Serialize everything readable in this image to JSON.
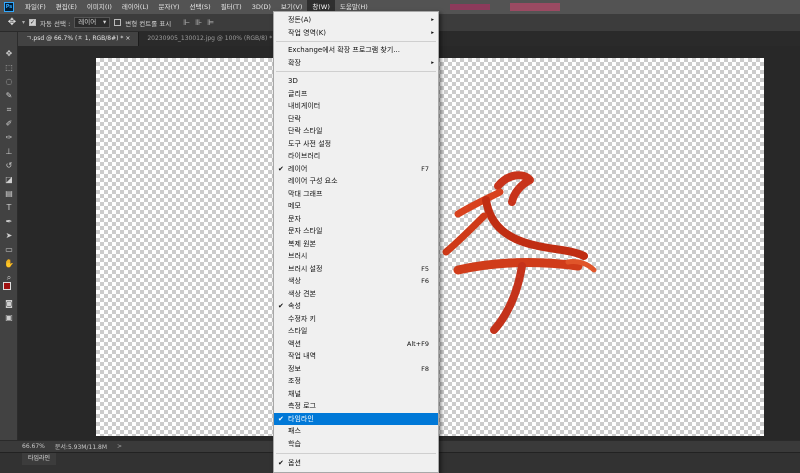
{
  "menubar": {
    "logo": "Ps",
    "items": [
      "파일(F)",
      "편집(E)",
      "이미지(I)",
      "레이어(L)",
      "문자(Y)",
      "선택(S)",
      "필터(T)",
      "3D(D)",
      "보기(V)",
      "창(W)",
      "도움말(H)"
    ]
  },
  "options": {
    "auto_select_label": "자동 선택 :",
    "auto_select_value": "레이어",
    "transform_label": "변형 컨트롤 표시"
  },
  "tabs": [
    {
      "label": "ㄱ.psd @ 66.7% (ㅊ 1, RGB/8#) *",
      "close": "×"
    },
    {
      "label": "20230905_130012.jpg @ 100% (RGB/8) *",
      "close": "×"
    }
  ],
  "status": {
    "zoom": "66.67%",
    "doc": "문서:5.93M/11.8M",
    "arrow": ">"
  },
  "timeline": {
    "tab_label": "타임라인"
  },
  "window_menu": {
    "accent_color": "#0078d7",
    "items": [
      {
        "label": "정돈(A)",
        "submenu": "▸"
      },
      {
        "label": "작업 영역(K)",
        "submenu": "▸"
      },
      {
        "separator": true
      },
      {
        "label": "Exchange에서 확장 프로그램 찾기..."
      },
      {
        "label": "확장",
        "submenu": "▸"
      },
      {
        "separator": true
      },
      {
        "label": "3D"
      },
      {
        "label": "글리프"
      },
      {
        "label": "내비게이터"
      },
      {
        "label": "단락"
      },
      {
        "label": "단락 스타일"
      },
      {
        "label": "도구 사전 설정"
      },
      {
        "label": "라이브러리"
      },
      {
        "label": "레이어",
        "check": "✔",
        "shortcut": "F7"
      },
      {
        "label": "레이어 구성 요소"
      },
      {
        "label": "막대 그래프"
      },
      {
        "label": "메모"
      },
      {
        "label": "문자"
      },
      {
        "label": "문자 스타일"
      },
      {
        "label": "복제 원본"
      },
      {
        "label": "브러시"
      },
      {
        "label": "브러시 설정",
        "shortcut": "F5"
      },
      {
        "label": "색상",
        "shortcut": "F6"
      },
      {
        "label": "색상 견본"
      },
      {
        "label": "속성",
        "check": "✔"
      },
      {
        "label": "수정자 키"
      },
      {
        "label": "스타일"
      },
      {
        "label": "액션",
        "shortcut": "Alt+F9"
      },
      {
        "label": "작업 내역"
      },
      {
        "label": "정보",
        "shortcut": "F8"
      },
      {
        "label": "조정"
      },
      {
        "label": "채널"
      },
      {
        "label": "측정 로그"
      },
      {
        "label": "타임라인",
        "check": "✔",
        "highlighted": true
      },
      {
        "label": "패스"
      },
      {
        "label": "학습"
      },
      {
        "separator": true
      },
      {
        "label": "옵션",
        "check": "✔"
      }
    ]
  }
}
